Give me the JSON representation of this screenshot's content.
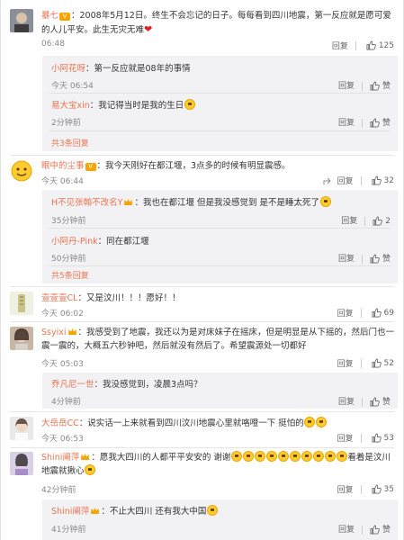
{
  "icons": {
    "like": "thumb-up-icon",
    "forward": "forward-icon",
    "vip": "vip-badge",
    "crown": "crown-badge",
    "heart": "heart-emoji"
  },
  "comments": [
    {
      "name": "暴七",
      "text": "：2008年5月12日。终生不会忘记的日子。每每看到四川地震，第一反应就是愿可爱的人儿平安。此生无灾无难",
      "time": "06:48",
      "reply": "回复",
      "likes": "125",
      "replies": [
        {
          "name": "小阿花呀",
          "text": "：第一反应就是08年的事情",
          "time": "今天 06:54",
          "reply": "回复",
          "likes": "赞"
        },
        {
          "name": "易大宝xin",
          "text": "：我记得当时是我的生日",
          "time": "2分钟前",
          "reply": "回复",
          "likes": "赞"
        }
      ],
      "more": "共3条回复"
    },
    {
      "name": "眼中的尘事",
      "text": "：我今天刚好在都江堰，3点多的时候有明显震感。",
      "time": "今天 06:44",
      "reply": "回复",
      "likes": "32",
      "replies": [
        {
          "name": "H不见张翰不改名Y",
          "text": "：我也在都江堰 但是我没感觉到 是不是睡太死了",
          "time": "35分钟前",
          "reply": "回复",
          "likes": "2"
        },
        {
          "name": "小阿丹-Pink",
          "text": "：同在都江堰",
          "time": "50分钟前",
          "reply": "回复",
          "likes": "赞"
        }
      ],
      "more": "共5条回复"
    },
    {
      "name": "壹壹壹CL",
      "text": "：又是汶川！！！愿好！！",
      "time": "今天 06:02",
      "reply": "回复",
      "likes": "69"
    },
    {
      "name": "Ssyixi",
      "text": "：我感受到了地震，我还以为是对床妹子在摇床，但是明显是从下摇的，然后门也一震一震的，大概五六秒钟吧，然后就没有然后了。希望震源处一切都好",
      "time": "今天 05:03",
      "reply": "回复",
      "likes": "52",
      "replies": [
        {
          "name": "乔凡尼一世",
          "text": "：我没感觉到，凌晨3点吗？",
          "time": "4分钟前",
          "reply": "回复",
          "likes": "赞"
        }
      ]
    },
    {
      "name": "大岳岳CC",
      "text": "：说实话一上来就看到四川汶川地震心里就咯噔一下 挺怕的",
      "time": "今天 06:53",
      "reply": "回复",
      "likes": "53"
    },
    {
      "name": "Shini阐萍",
      "text_a": "：愿我大四川的人都平平安安的 谢谢",
      "text_b": "看着是汶川地震就揪心",
      "time": "42分钟前",
      "reply": "回复",
      "likes": "35",
      "replies": [
        {
          "name": "Shini阐萍",
          "text": "：不止大四川 还有我大中国",
          "time": "41分钟前",
          "reply": "回复",
          "likes": "赞"
        }
      ]
    }
  ]
}
